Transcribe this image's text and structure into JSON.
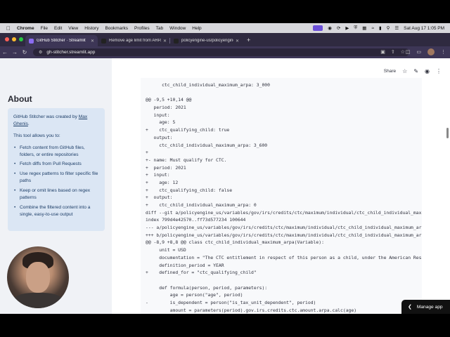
{
  "menubar": {
    "app": "Chrome",
    "items": [
      "File",
      "Edit",
      "View",
      "History",
      "Bookmarks",
      "Profiles",
      "Tab",
      "Window",
      "Help"
    ],
    "datetime": "Sat Aug 17  1:05 PM"
  },
  "tabs": [
    {
      "label": "GitHub Stitcher · Streamlit",
      "favicon_color": "#8b6cf0",
      "active": true
    },
    {
      "label": "Remove age limit from ARPA",
      "favicon_color": "#222222",
      "active": false
    },
    {
      "label": "policyengine-us/policyengine",
      "favicon_color": "#222222",
      "active": false
    }
  ],
  "address": {
    "url": "gh-stitcher.streamlit.app"
  },
  "header": {
    "share_label": "Share"
  },
  "sidebar": {
    "title": "About",
    "intro_prefix": "GitHub Stitcher was created by ",
    "author_link": "Max Ghenis",
    "intro_suffix": ".",
    "allows": "This tool allows you to:",
    "features": [
      "Fetch content from GitHub files, folders, or entire repositories",
      "Fetch diffs from Pull Requests",
      "Use regex patterns to filter specific file paths",
      "Keep or omit lines based on regex patterns",
      "Combine the filtered content into a single, easy-to-use output"
    ]
  },
  "code_lines": [
    "      ctc_child_individual_maximum_arpa: 3_000",
    "",
    "@@ -9,5 +10,14 @@",
    "   period: 2021",
    "   input:",
    "     age: 5",
    "+    ctc_qualifying_child: true",
    "   output:",
    "     ctc_child_individual_maximum_arpa: 3_600",
    "+",
    "+- name: Must qualify for CTC.",
    "+  period: 2021",
    "+  input:",
    "+    age: 12",
    "+    ctc_qualifying_child: false",
    "+  output:",
    "+    ctc_child_individual_maximum_arpa: 0",
    "diff --git a/policyengine_us/variables/gov/irs/credits/ctc/maximum/individual/ctc_child_individual_maximum_arpa.py",
    "index 799d4e42570..ff73d577234 100644",
    "--- a/policyengine_us/variables/gov/irs/credits/ctc/maximum/individual/ctc_child_individual_maximum_arpa.py",
    "+++ b/policyengine_us/variables/gov/irs/credits/ctc/maximum/individual/ctc_child_individual_maximum_arpa.py",
    "@@ -8,9 +8,8 @@ class ctc_child_individual_maximum_arpa(Variable):",
    "     unit = USD",
    "     documentation = \"The CTC entitlement in respect of this person as a child, under the American Rescue Plan Act.\"",
    "     definition_period = YEAR",
    "+    defined_for = \"ctc_qualifying_child\"",
    "",
    "     def formula(person, period, parameters):",
    "         age = person(\"age\", period)",
    "-        is_dependent = person(\"is_tax_unit_dependent\", period)",
    "         amount = parameters(period).gov.irs.credits.ctc.amount.arpa.calc(age)"
  ],
  "manage_app": "Manage app"
}
